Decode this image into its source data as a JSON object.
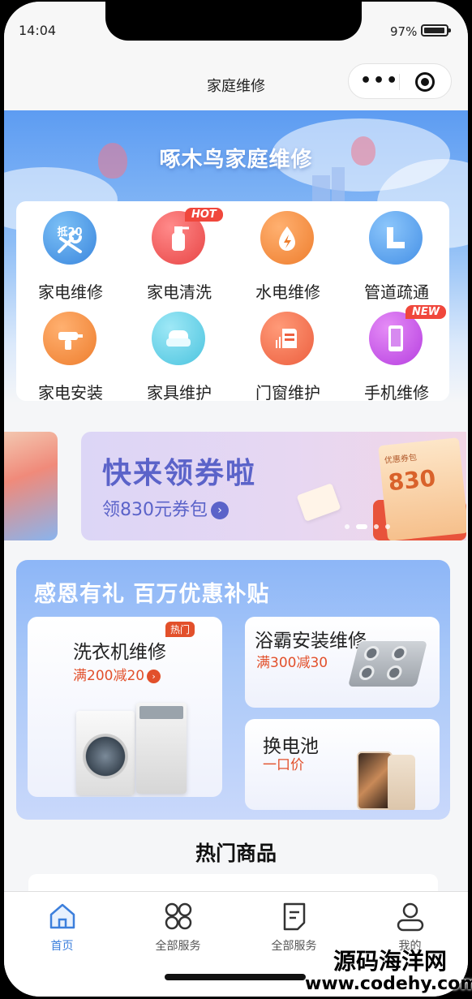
{
  "status_bar": {
    "time": "14:04",
    "battery": "97%",
    "battery_level": 0.97
  },
  "navbar": {
    "title": "家庭维修"
  },
  "hero": {
    "title": "啄木鸟家庭维修"
  },
  "services": [
    {
      "label": "家电维修",
      "icon": "wrench-icon",
      "color": "#4a90e2",
      "badge_text": "抵20"
    },
    {
      "label": "家电清洗",
      "icon": "spray-bottle-icon",
      "color": "#f05a5a",
      "tag": "HOT"
    },
    {
      "label": "水电维修",
      "icon": "lightning-drop-icon",
      "color": "#f08a3c"
    },
    {
      "label": "管道疏通",
      "icon": "pipe-icon",
      "color": "#4a90e2"
    },
    {
      "label": "家电安装",
      "icon": "drill-icon",
      "color": "#f08a3c"
    },
    {
      "label": "家具维护",
      "icon": "sofa-icon",
      "color": "#4ec8e0"
    },
    {
      "label": "门窗维护",
      "icon": "door-icon",
      "color": "#f06a4c"
    },
    {
      "label": "手机维修",
      "icon": "phone-icon",
      "color": "#c348e6",
      "tag": "NEW"
    }
  ],
  "banner": {
    "headline": "快来领券啦",
    "subline": "领830元券包",
    "box_caption": "优惠券包",
    "box_amount": "830",
    "page_count": 4,
    "active_index": 1
  },
  "promo": {
    "title": "感恩有礼 百万优惠补贴",
    "cards": [
      {
        "title": "洗衣机维修",
        "subtitle": "满200减20",
        "tag": "热门"
      },
      {
        "title": "浴霸安装维修",
        "subtitle": "满300减30"
      },
      {
        "title": "换电池",
        "subtitle": "一口价"
      }
    ]
  },
  "hot_section": {
    "title": "热门商品"
  },
  "tabbar": {
    "tabs": [
      {
        "label": "首页",
        "icon": "home-icon",
        "active": true
      },
      {
        "label": "全部服务",
        "icon": "grid-icon",
        "active": false
      },
      {
        "label": "全部服务",
        "icon": "document-icon",
        "active": false
      },
      {
        "label": "我的",
        "icon": "user-icon",
        "active": false
      }
    ]
  },
  "watermark": {
    "line1": "源码海洋网",
    "line2": "www.codehy.com"
  }
}
